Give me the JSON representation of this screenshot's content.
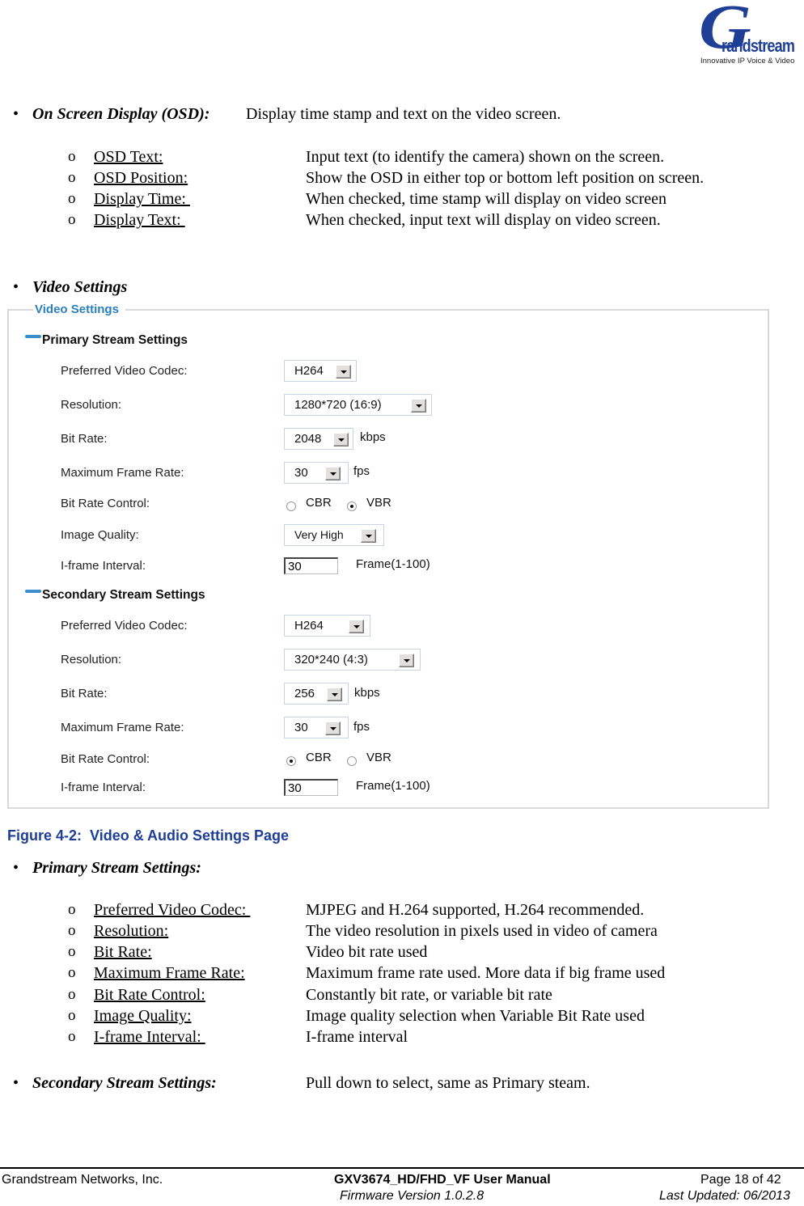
{
  "logo": {
    "initial": "G",
    "wordmark": "randstream",
    "tagline": "Innovative IP Voice & Video"
  },
  "osd": {
    "heading": "On Screen Display (OSD):",
    "description": "Display time stamp and text on the video screen.",
    "items": [
      {
        "term": "OSD Text:",
        "desc": "Input text (to identify the camera) shown on the screen."
      },
      {
        "term": "OSD Position:",
        "desc": "Show the OSD in either top or bottom left position on screen."
      },
      {
        "term": "Display Time: ",
        "desc": "When checked, time stamp will display on video screen"
      },
      {
        "term": "Display Text: ",
        "desc": "When checked, input text will display on video screen."
      }
    ]
  },
  "video_settings_heading": "Video Settings",
  "figure": {
    "legend": "Video Settings",
    "primary": {
      "title": "Primary Stream Settings",
      "codec_label": "Preferred Video Codec:",
      "codec_value": "H264",
      "resolution_label": "Resolution:",
      "resolution_value": "1280*720 (16:9)",
      "bitrate_label": "Bit Rate:",
      "bitrate_value": "2048",
      "bitrate_unit": "kbps",
      "framerate_label": "Maximum Frame Rate:",
      "framerate_value": "30",
      "framerate_unit": "fps",
      "brc_label": "Bit Rate Control:",
      "brc_options": [
        "CBR",
        "VBR"
      ],
      "brc_selected": "VBR",
      "quality_label": "Image Quality:",
      "quality_value": "Very High",
      "iframe_label": "I-frame Interval:",
      "iframe_value": "30",
      "iframe_hint": "Frame(1-100)"
    },
    "secondary": {
      "title": "Secondary Stream Settings",
      "codec_label": "Preferred Video Codec:",
      "codec_value": "H264",
      "resolution_label": "Resolution:",
      "resolution_value": "320*240 (4:3)",
      "bitrate_label": "Bit Rate:",
      "bitrate_value": "256",
      "bitrate_unit": "kbps",
      "framerate_label": "Maximum Frame Rate:",
      "framerate_value": "30",
      "framerate_unit": "fps",
      "brc_label": "Bit Rate Control:",
      "brc_options": [
        "CBR",
        "VBR"
      ],
      "brc_selected": "CBR",
      "iframe_label": "I-frame Interval:",
      "iframe_value": "30",
      "iframe_hint": "Frame(1-100)"
    },
    "caption": "Figure 4-2:  Video & Audio Settings Page"
  },
  "primary_stream": {
    "heading": "Primary Stream Settings:",
    "items": [
      {
        "term": "Preferred Video Codec: ",
        "desc": "MJPEG and H.264 supported, H.264 recommended."
      },
      {
        "term": "Resolution:",
        "desc": "The video resolution in pixels used in video of camera"
      },
      {
        "term": "Bit Rate:",
        "desc": "Video bit rate used"
      },
      {
        "term": "Maximum Frame Rate:",
        "desc": "Maximum frame rate used. More data if big frame used"
      },
      {
        "term": "Bit Rate Control:",
        "desc": "Constantly bit rate, or variable bit rate"
      },
      {
        "term": "Image Quality:",
        "desc": "Image quality selection when Variable Bit Rate used"
      },
      {
        "term": "I-frame Interval: ",
        "desc": "I-frame interval"
      }
    ]
  },
  "secondary_stream": {
    "heading": "Secondary Stream Settings:",
    "description": "Pull down to select, same as Primary steam."
  },
  "footer": {
    "company": "Grandstream Networks, Inc.",
    "manual": "GXV3674_HD/FHD_VF User Manual",
    "firmware": "Firmware Version 1.0.2.8",
    "page": "Page 18 of 42",
    "updated": "Last Updated: 06/2013"
  }
}
